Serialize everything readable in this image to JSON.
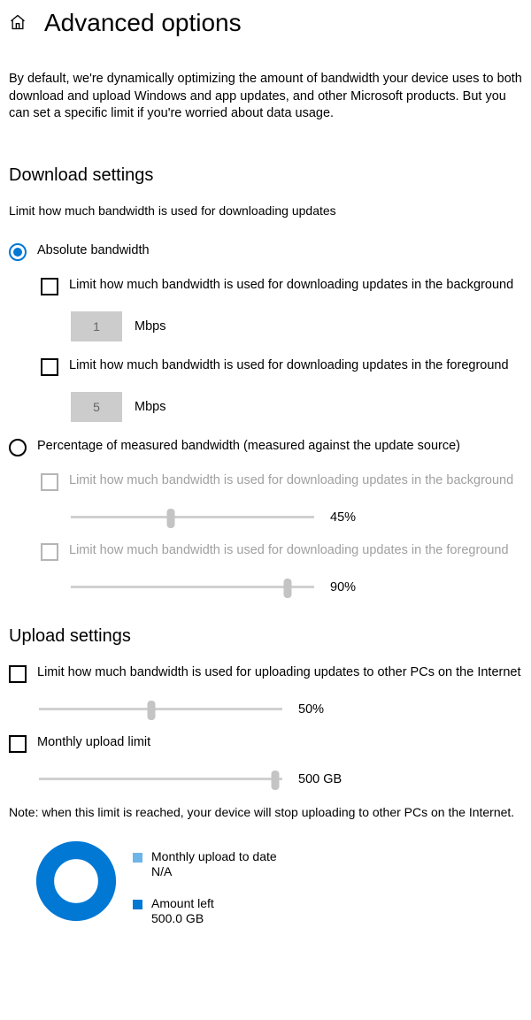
{
  "page": {
    "title": "Advanced options",
    "intro": "By default, we're dynamically optimizing the amount of bandwidth your device uses to both download and upload Windows and app updates, and other Microsoft products. But you can set a specific limit if you're worried about data usage."
  },
  "download": {
    "heading": "Download settings",
    "subdesc": "Limit how much bandwidth is used for downloading updates",
    "radio_absolute": "Absolute bandwidth",
    "radio_percent": "Percentage of measured bandwidth (measured against the update source)",
    "bg_checkbox": "Limit how much bandwidth is used for downloading updates in the background",
    "bg_value": "1",
    "fg_checkbox": "Limit how much bandwidth is used for downloading updates in the foreground",
    "fg_value": "5",
    "mbps": "Mbps",
    "pct_bg_checkbox": "Limit how much bandwidth is used for downloading updates in the background",
    "pct_bg_value": "45%",
    "pct_fg_checkbox": "Limit how much bandwidth is used for downloading updates in the foreground",
    "pct_fg_value": "90%"
  },
  "upload": {
    "heading": "Upload settings",
    "bw_checkbox": "Limit how much bandwidth is used for uploading updates to other PCs on the Internet",
    "bw_value": "50%",
    "monthly_checkbox": "Monthly upload limit",
    "monthly_value": "500 GB",
    "note": "Note: when this limit is reached, your device will stop uploading to other PCs on the Internet."
  },
  "chart": {
    "legend1_label": "Monthly upload to date",
    "legend1_value": "N/A",
    "legend2_label": "Amount left",
    "legend2_value": "500.0 GB"
  },
  "chart_data": {
    "type": "pie",
    "title": "Monthly upload",
    "series": [
      {
        "name": "Monthly upload to date",
        "value": 0,
        "color": "#6db5e8"
      },
      {
        "name": "Amount left",
        "value": 500.0,
        "color": "#0078d4"
      }
    ]
  }
}
